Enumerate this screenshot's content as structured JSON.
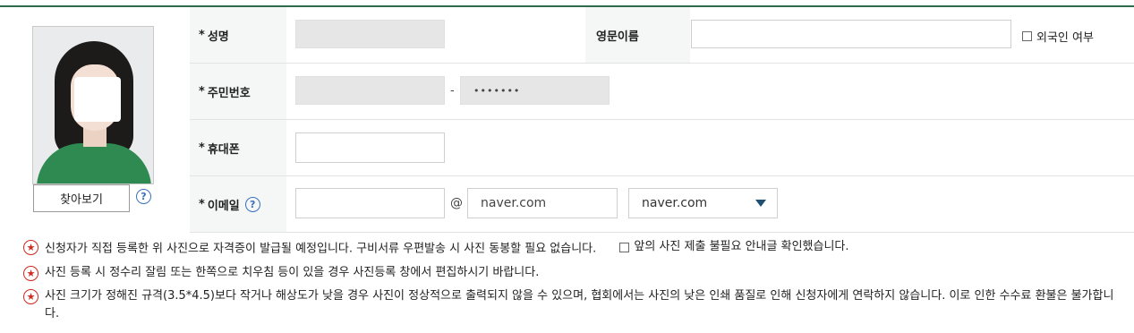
{
  "photo": {
    "find_button_label": "찾아보기"
  },
  "form": {
    "name": {
      "label": "성명",
      "value": " "
    },
    "english_name": {
      "label": "영문이름",
      "value": ""
    },
    "foreigner": {
      "label": "외국인 여부"
    },
    "resident_number": {
      "label": "주민번호",
      "front_value": "",
      "separator": "-",
      "back_value": "•••••••"
    },
    "phone": {
      "label": "휴대폰",
      "value": ""
    },
    "email": {
      "label": "이메일",
      "id_value": "",
      "at": "@",
      "domain_value": "naver.com",
      "domain_select": "naver.com"
    },
    "required_mark": "*"
  },
  "notes": {
    "items": [
      "신청자가 직접 등록한 위 사진으로 자격증이 발급될 예정입니다. 구비서류 우편발송 시 사진 동봉할 필요 없습니다.",
      "사진 등록 시 정수리 잘림 또는 한쪽으로 치우침 등이 있을 경우 사진등록 창에서 편집하시기 바랍니다.",
      "사진 크기가 정해진 규격(3.5*4.5)보다 작거나 해상도가 낮을 경우 사진이 정상적으로 출력되지 않을 수 있으며, 협회에서는 사진의 낮은 인쇄 품질로 인해 신청자에게 연락하지 않습니다. 이로 인한 수수료 환불은 불가합니다."
    ],
    "confirm_label": "앞의 사진 제출 불필요 안내글 확인했습니다."
  },
  "icons": {
    "help": "question-circle-icon",
    "star": "star-circle-icon",
    "select_arrow": "triangle-down-icon"
  },
  "colors": {
    "top_border": "#2e6a4e",
    "label_bg": "#f4f7f5",
    "help_blue": "#3b6fbf",
    "star_red": "#d0291f"
  }
}
